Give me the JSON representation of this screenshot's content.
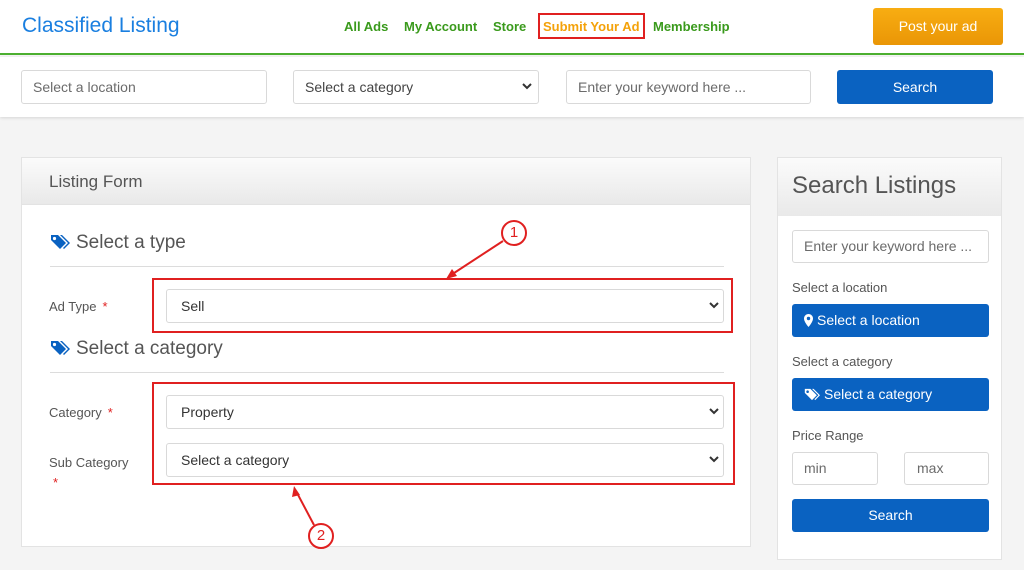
{
  "header": {
    "brand": "Classified Listing",
    "nav": [
      {
        "label": "All Ads"
      },
      {
        "label": "My Account"
      },
      {
        "label": "Store"
      },
      {
        "label": "Submit Your Ad",
        "active": true
      },
      {
        "label": "Membership"
      }
    ],
    "post_button": "Post your ad"
  },
  "search_bar": {
    "location_placeholder": "Select a location",
    "category_value": "Select a category",
    "keyword_placeholder": "Enter your keyword here ...",
    "search_label": "Search"
  },
  "listing_form": {
    "title": "Listing Form",
    "type_section": {
      "title": "Select a type",
      "ad_type_label": "Ad Type",
      "ad_type_value": "Sell"
    },
    "category_section": {
      "title": "Select a category",
      "category_label": "Category",
      "category_value": "Property",
      "sub_category_label": "Sub Category",
      "sub_category_value": "Select a category"
    },
    "required_marker": "*"
  },
  "sidebar": {
    "title": "Search Listings",
    "keyword_placeholder": "Enter your keyword here ...",
    "location_label": "Select a location",
    "location_button": "Select a location",
    "category_label": "Select a category",
    "category_button": "Select a category",
    "price_label": "Price Range",
    "min_placeholder": "min",
    "max_placeholder": "max",
    "search_label": "Search"
  },
  "annotations": {
    "callout_1": "1",
    "callout_2": "2",
    "color": "#e02020"
  },
  "colors": {
    "brand": "#1a7fe0",
    "nav": "#3a9a1c",
    "nav_active": "#f4a20a",
    "primary_button": "#0a62c1",
    "post_button": "#f4a20a"
  }
}
